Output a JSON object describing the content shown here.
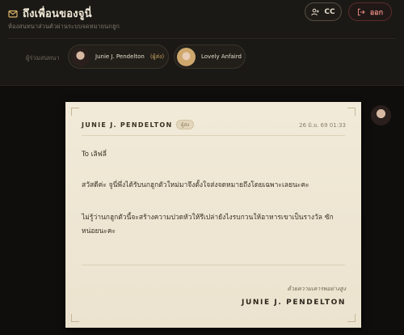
{
  "header": {
    "title": "ถึงเพื่อนของจูนี่",
    "subtitle": "ห้องสนทนาส่วนตัวผ่านระบบจดหมายนกฮูก",
    "cc_label": "CC",
    "exit_label": "ออก"
  },
  "participants": {
    "label": "ผู้ร่วมสนทนา",
    "items": [
      {
        "name": "Junie J. Pendelton",
        "badge": "(ผู้ส่ง)"
      },
      {
        "name": "Lovely Anfaird",
        "badge": ""
      }
    ]
  },
  "letter": {
    "sender": "JUNIE J. PENDELTON",
    "sender_badge": "ผู้ส่ง",
    "timestamp": "26 มิ.ย. 69 01:33",
    "greeting": "To เลิฟลี่",
    "paragraph_1": "สวัสดีค่ะ จูนี่พึ่งได้รับนกฮูกตัวใหม่มาจึงตั้งใจส่งจดหมายถึงโดยเฉพาะเลยนะคะ",
    "paragraph_2": "ไม่รู้ว่านกฮูกตัวนี้จะสร้างความปวดหัวให้รึเปล่ายังไงรบกวนให้อาหารเขาเป็นรางวัล ซักหน่อยนะคะ",
    "closing": "ด้วยความเคารพอย่างสูง",
    "signature": "JUNIE J. PENDELTON"
  },
  "colors": {
    "background": "#0f0e0c",
    "header": "#1b1915",
    "paper": "#f1ead8",
    "accent_gold": "#c9a25c",
    "exit_red": "#e0857b"
  },
  "icons": [
    "mail-icon",
    "add-user-icon",
    "logout-icon"
  ]
}
